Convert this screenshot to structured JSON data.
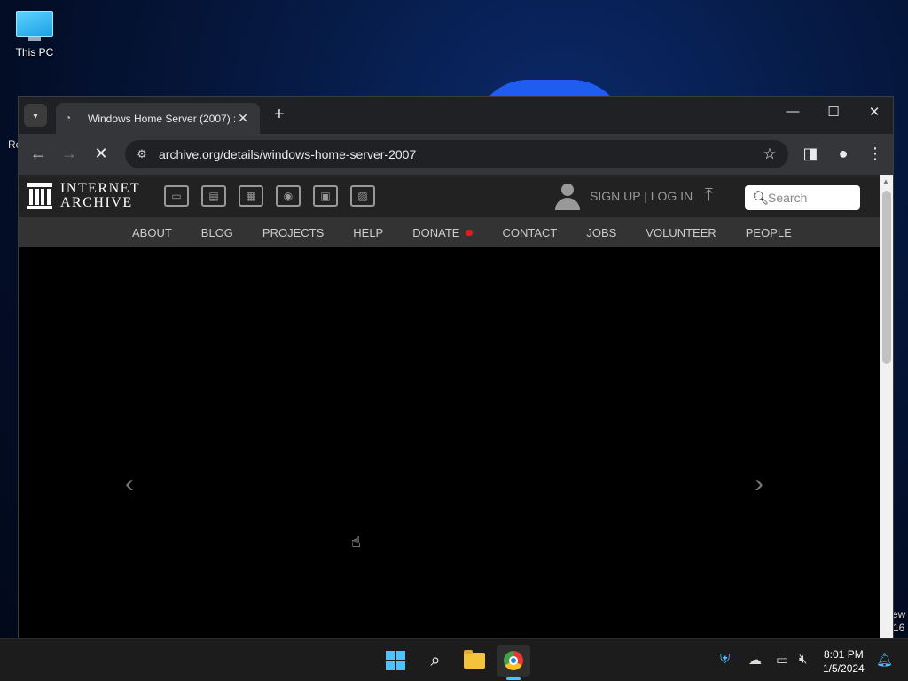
{
  "desktop": {
    "this_pc_label": "This PC",
    "fragments": {
      "recycle": "Re",
      "right_top": "ew",
      "right_bottom": "16"
    }
  },
  "browser": {
    "tab_title": "Windows Home Server (2007) :",
    "url": "archive.org/details/windows-home-server-2007",
    "icons": {
      "tab_dropdown": "chevron-down-icon",
      "favicon": "loading-icon",
      "tab_close": "close-icon",
      "new_tab": "plus-icon",
      "minimize": "minimize-icon",
      "maximize": "maximize-icon",
      "close": "close-icon",
      "back": "back-arrow-icon",
      "forward": "forward-arrow-icon",
      "stop": "stop-icon",
      "site_info": "tune-icon",
      "bookmark": "star-icon",
      "side_panel": "side-panel-icon",
      "profile": "profile-icon",
      "menu": "kebab-menu-icon"
    }
  },
  "ia": {
    "logo_line1": "INTERNET",
    "logo_line2": "ARCHIVE",
    "media_icons": [
      "web-icon",
      "texts-icon",
      "video-icon",
      "audio-icon",
      "software-icon",
      "images-icon"
    ],
    "signin": "SIGN UP | LOG IN",
    "search_placeholder": "Search",
    "nav": [
      "ABOUT",
      "BLOG",
      "PROJECTS",
      "HELP",
      "DONATE",
      "CONTACT",
      "JOBS",
      "VOLUNTEER",
      "PEOPLE"
    ],
    "donate_heart_color": "#e21c1c"
  },
  "taskbar": {
    "apps": [
      "start-icon",
      "search-icon",
      "file-explorer-icon",
      "chrome-icon"
    ],
    "tray_icons": [
      "security-warning-icon",
      "onedrive-icon",
      "network-icon",
      "volume-muted-icon"
    ],
    "time": "8:01 PM",
    "date": "1/5/2024"
  }
}
